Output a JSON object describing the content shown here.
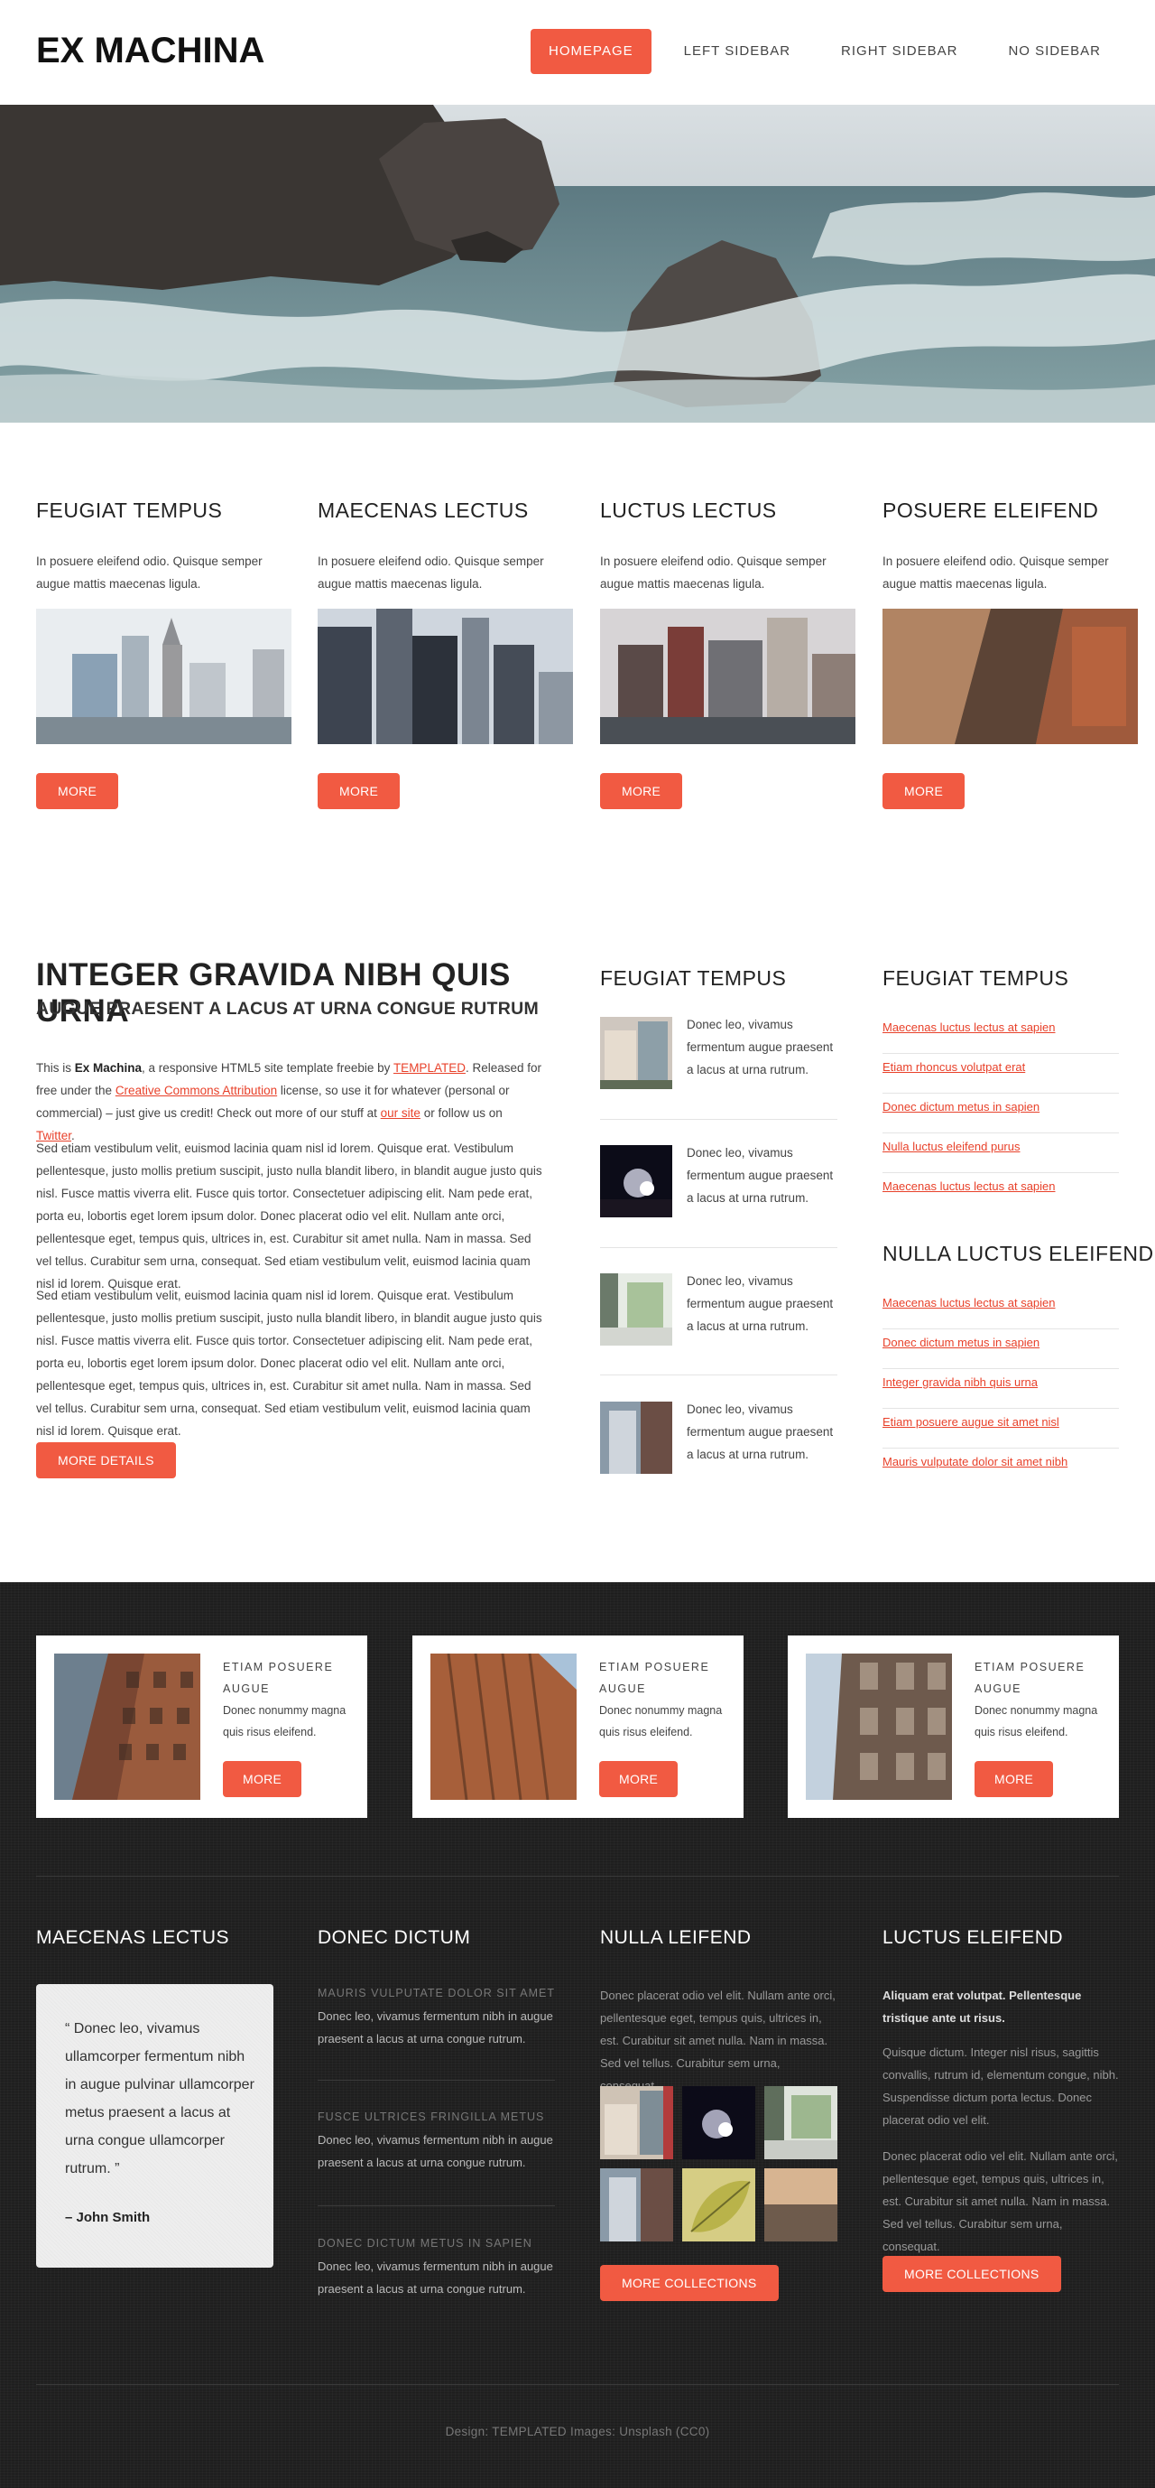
{
  "site": {
    "logo": "EX MACHINA"
  },
  "nav": [
    {
      "label": "HOMEPAGE"
    },
    {
      "label": "LEFT SIDEBAR"
    },
    {
      "label": "RIGHT SIDEBAR"
    },
    {
      "label": "NO SIDEBAR"
    }
  ],
  "features": [
    {
      "title": "FEUGIAT TEMPUS",
      "text": "In posuere eleifend odio. Quisque semper augue mattis maecenas ligula.",
      "button": "MORE"
    },
    {
      "title": "MAECENAS LECTUS",
      "text": "In posuere eleifend odio. Quisque semper augue mattis maecenas ligula.",
      "button": "MORE"
    },
    {
      "title": "LUCTUS LECTUS",
      "text": "In posuere eleifend odio. Quisque semper augue mattis maecenas ligula.",
      "button": "MORE"
    },
    {
      "title": "POSUERE ELEIFEND",
      "text": "In posuere eleifend odio. Quisque semper augue mattis maecenas ligula.",
      "button": "MORE"
    }
  ],
  "main": {
    "title": "INTEGER GRAVIDA NIBH QUIS URNA",
    "subtitle": "AUGUE PRAESENT A LACUS AT URNA CONGUE RUTRUM",
    "intro": {
      "p1": "This is ",
      "brand": "Ex Machina",
      "p2": ", a responsive HTML5 site template freebie by ",
      "link1": "TEMPLATED",
      "p3": ". Released for free under the ",
      "link2": "Creative Commons Attribution",
      "p4": " license, so use it for whatever (personal or commercial) – just give us credit! Check out more of our stuff at ",
      "link3": "our site",
      "p5": " or follow us on ",
      "link4": "Twitter",
      "p6": "."
    },
    "para2": "Sed etiam vestibulum velit, euismod lacinia quam nisl id lorem. Quisque erat. Vestibulum pellentesque, justo mollis pretium suscipit, justo nulla blandit libero, in blandit augue justo quis nisl. Fusce mattis viverra elit. Fusce quis tortor. Consectetuer adipiscing elit. Nam pede erat, porta eu, lobortis eget lorem ipsum dolor. Donec placerat odio vel elit. Nullam ante orci, pellentesque eget, tempus quis, ultrices in, est. Curabitur sit amet nulla. Nam in massa. Sed vel tellus. Curabitur sem urna, consequat. Sed etiam vestibulum velit, euismod lacinia quam nisl id lorem. Quisque erat.",
    "para3": "Sed etiam vestibulum velit, euismod lacinia quam nisl id lorem. Quisque erat. Vestibulum pellentesque, justo mollis pretium suscipit, justo nulla blandit libero, in blandit augue justo quis nisl. Fusce mattis viverra elit. Fusce quis tortor. Consectetuer adipiscing elit. Nam pede erat, porta eu, lobortis eget lorem ipsum dolor. Donec placerat odio vel elit. Nullam ante orci, pellentesque eget, tempus quis, ultrices in, est. Curabitur sit amet nulla. Nam in massa. Sed vel tellus. Curabitur sem urna, consequat. Sed etiam vestibulum velit, euismod lacinia quam nisl id lorem. Quisque erat.",
    "button": "MORE DETAILS"
  },
  "middle": {
    "title": "FEUGIAT TEMPUS",
    "items": [
      {
        "text": "Donec leo, vivamus fermentum augue praesent a lacus at urna rutrum."
      },
      {
        "text": "Donec leo, vivamus fermentum augue praesent a lacus at urna rutrum."
      },
      {
        "text": "Donec leo, vivamus fermentum augue praesent a lacus at urna rutrum."
      },
      {
        "text": "Donec leo, vivamus fermentum augue praesent a lacus at urna rutrum."
      }
    ]
  },
  "right": {
    "title1": "FEUGIAT TEMPUS",
    "links1": [
      "Maecenas luctus lectus at sapien",
      "Etiam rhoncus volutpat erat",
      "Donec dictum metus in sapien",
      "Nulla luctus eleifend purus",
      "Maecenas luctus lectus at sapien"
    ],
    "title2": "NULLA LUCTUS ELEIFEND",
    "links2": [
      "Maecenas luctus lectus at sapien",
      "Donec dictum metus in sapien",
      "Integer gravida nibh quis urna",
      "Etiam posuere augue sit amet nisl",
      "Mauris vulputate dolor sit amet nibh"
    ]
  },
  "cards": [
    {
      "title": "ETIAM POSUERE AUGUE",
      "text": "Donec nonummy magna quis risus eleifend.",
      "button": "MORE"
    },
    {
      "title": "ETIAM POSUERE AUGUE",
      "text": "Donec nonummy magna quis risus eleifend.",
      "button": "MORE"
    },
    {
      "title": "ETIAM POSUERE AUGUE",
      "text": "Donec nonummy magna quis risus eleifend.",
      "button": "MORE"
    }
  ],
  "footer": {
    "col1": {
      "title": "MAECENAS LECTUS",
      "quote": "“ Donec leo, vivamus ullamcorper fermentum nibh in augue pulvinar ullamcorper metus praesent a lacus at urna congue ullamcorper rutrum. ”",
      "author": "–  John Smith"
    },
    "col2": {
      "title": "DONEC DICTUM",
      "items": [
        {
          "title": "MAURIS VULPUTATE DOLOR SIT AMET",
          "text": "Donec leo, vivamus fermentum nibh in augue praesent a lacus at urna congue rutrum."
        },
        {
          "title": "FUSCE ULTRICES FRINGILLA METUS",
          "text": "Donec leo, vivamus fermentum nibh in augue praesent a lacus at urna congue rutrum."
        },
        {
          "title": "DONEC DICTUM METUS IN SAPIEN",
          "text": "Donec leo, vivamus fermentum nibh in augue praesent a lacus at urna congue rutrum."
        }
      ]
    },
    "col3": {
      "title": "NULLA LEIFEND",
      "text": "Donec placerat odio vel elit. Nullam ante orci, pellentesque eget, tempus quis, ultrices in, est. Curabitur sit amet nulla. Nam in massa. Sed vel tellus. Curabitur sem urna, consequat.",
      "button": "MORE COLLECTIONS"
    },
    "col4": {
      "title": "LUCTUS ELEIFEND",
      "lead": "Aliquam erat volutpat. Pellentesque tristique ante ut risus.",
      "p1": "Quisque dictum. Integer nisl risus, sagittis convallis, rutrum id, elementum congue, nibh. Suspendisse dictum porta lectus. Donec placerat odio vel elit.",
      "p2": "Donec placerat odio vel elit. Nullam ante orci, pellentesque eget, tempus quis, ultrices in, est. Curabitur sit amet nulla. Nam in massa. Sed vel tellus. Curabitur sem urna, consequat.",
      "button": "MORE COLLECTIONS"
    },
    "copyright": "Design: TEMPLATED Images: Unsplash (CC0)"
  }
}
